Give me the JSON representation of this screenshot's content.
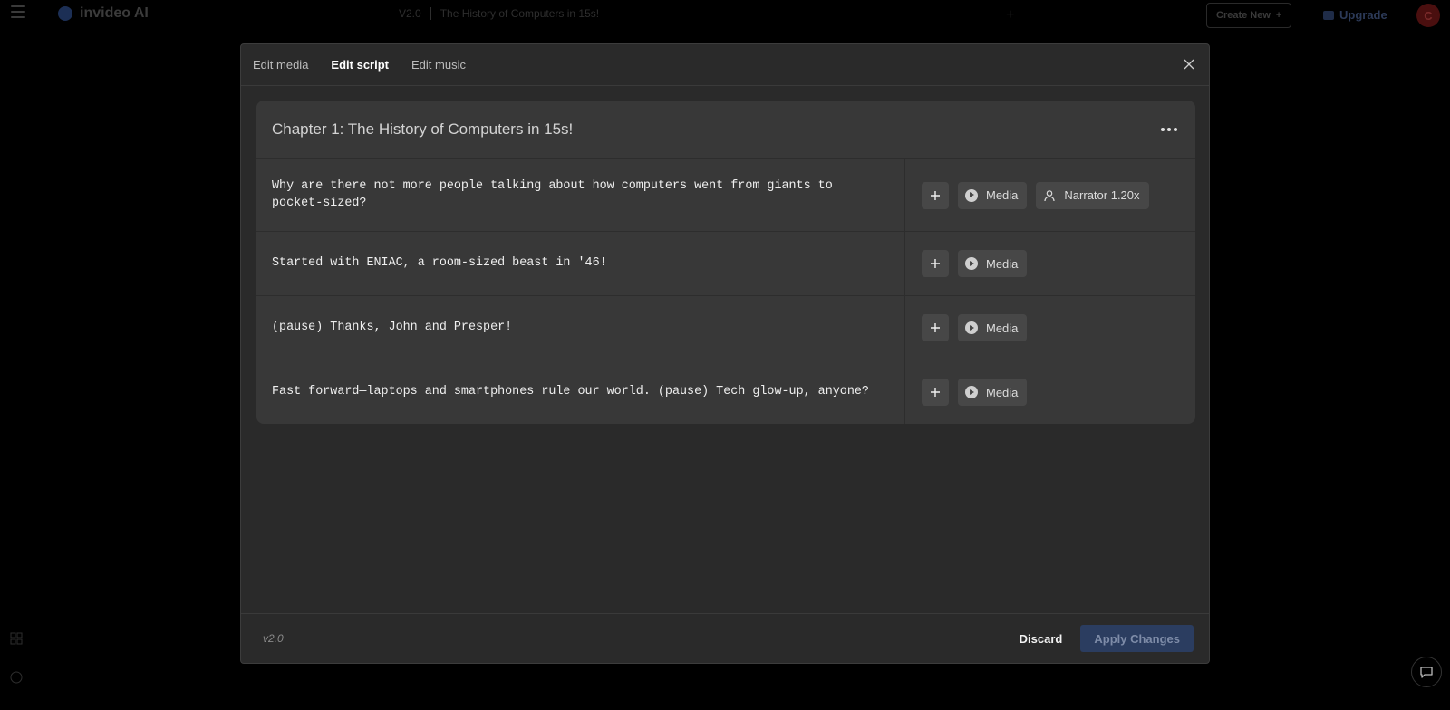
{
  "app": {
    "brand_name": "invideo AI",
    "project_tag": "V2.0",
    "project_title": "The History of Computers in 15s!",
    "create_new_label": "Create New",
    "upgrade_label": "Upgrade",
    "avatar_initial": "C"
  },
  "modal": {
    "tabs": [
      {
        "label": "Edit media",
        "active": false
      },
      {
        "label": "Edit script",
        "active": true
      },
      {
        "label": "Edit music",
        "active": false
      }
    ],
    "chapter": {
      "title": "Chapter 1: The History of Computers in 15s!",
      "scenes": [
        {
          "text": "Why are there not more people talking about how computers went from giants to pocket-sized?",
          "media_label": "Media",
          "narrator_label": "Narrator 1.20x"
        },
        {
          "text": "Started with ENIAC, a room-sized beast in '46!",
          "media_label": "Media"
        },
        {
          "text": "(pause) Thanks, John and Presper!",
          "media_label": "Media"
        },
        {
          "text": "Fast forward—laptops and smartphones rule our world. (pause) Tech glow-up, anyone?",
          "media_label": "Media"
        }
      ]
    },
    "footer": {
      "version": "v2.0",
      "discard_label": "Discard",
      "apply_label": "Apply Changes"
    }
  },
  "colors": {
    "background": "#000000",
    "modal_bg": "#2a2a2a",
    "card_bg": "#383838",
    "apply_bg": "#2b3d60"
  }
}
